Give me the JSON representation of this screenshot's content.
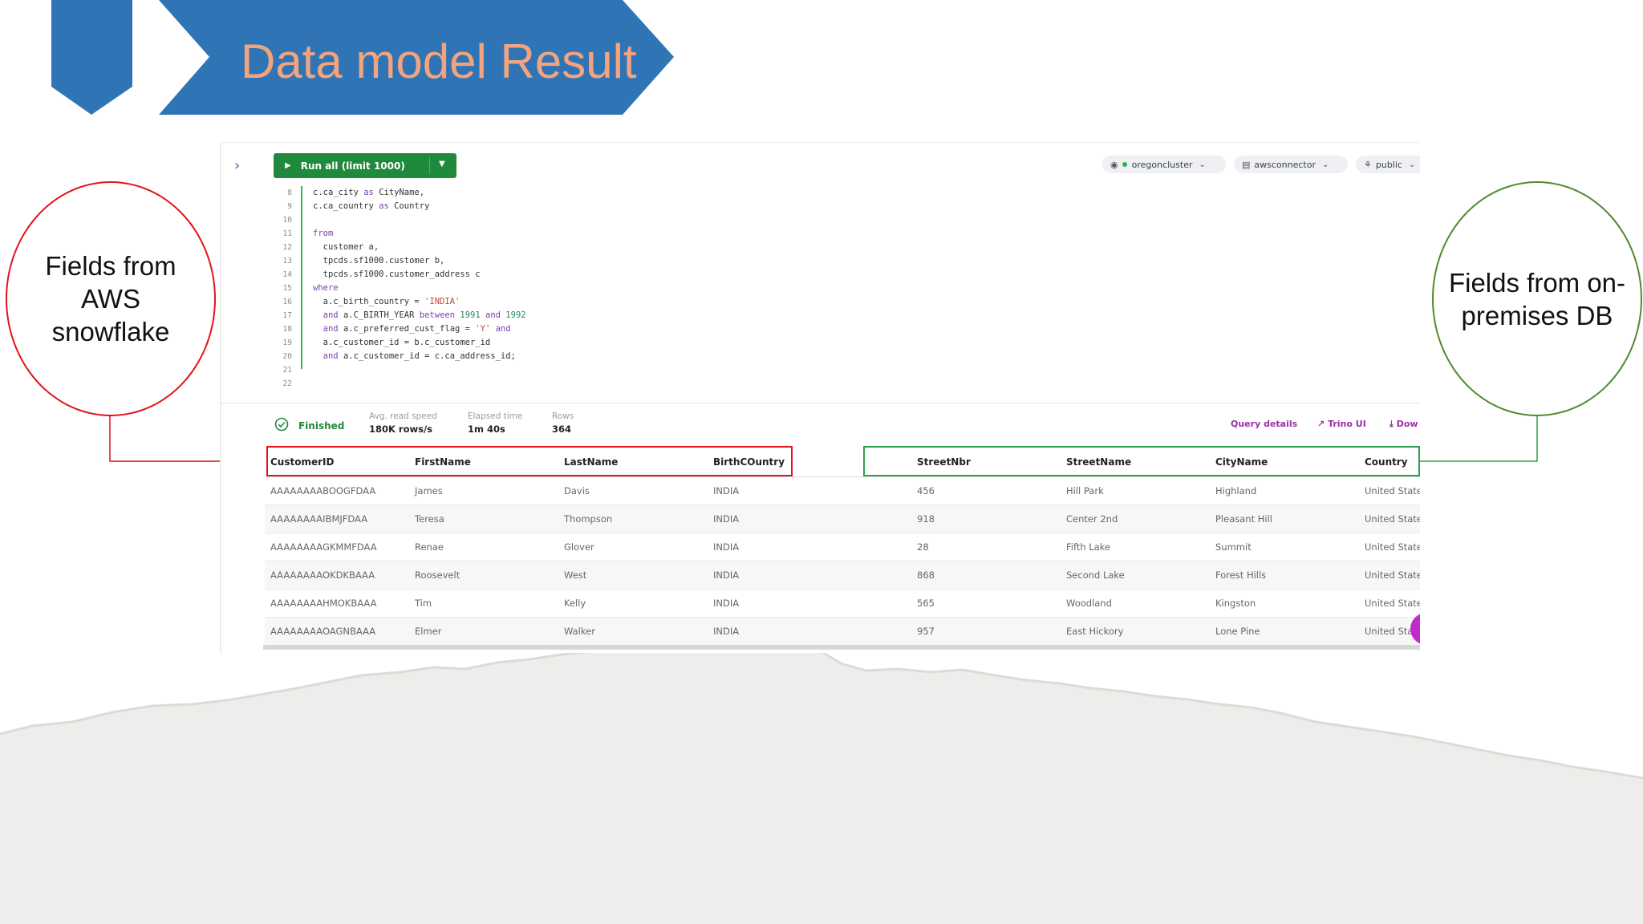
{
  "slide": {
    "title": "Data model Result",
    "callout_left": "Fields from AWS snowflake",
    "callout_right": "Fields from on-premises DB",
    "colors": {
      "banner": "#2f75b5",
      "title_text": "#f4a37f",
      "left_callout": "#e0141c",
      "right_callout": "#4e8a2f"
    }
  },
  "toolbar": {
    "run_label": "Run all (limit 1000)",
    "cluster": "oregoncluster",
    "connector": "awsconnector",
    "schema": "public"
  },
  "editor": {
    "lines": [
      {
        "n": "8",
        "html": "c.ca_city <span class=\"kw\">as</span> CityName,"
      },
      {
        "n": "9",
        "html": "c.ca_country <span class=\"kw\">as</span> Country"
      },
      {
        "n": "10",
        "html": ""
      },
      {
        "n": "11",
        "html": "<span class=\"kw\">from</span>"
      },
      {
        "n": "12",
        "html": "  customer a,"
      },
      {
        "n": "13",
        "html": "  tpcds.sf1000.customer b,"
      },
      {
        "n": "14",
        "html": "  tpcds.sf1000.customer_address c"
      },
      {
        "n": "15",
        "html": "<span class=\"kw\">where</span>"
      },
      {
        "n": "16",
        "html": "  a.c_birth_country = <span class=\"str\">'INDIA'</span>"
      },
      {
        "n": "17",
        "html": "  <span class=\"kw\">and</span> a.C_BIRTH_YEAR <span class=\"kw\">between</span> <span class=\"num\">1991</span> <span class=\"kw\">and</span> <span class=\"num\">1992</span>"
      },
      {
        "n": "18",
        "html": "  <span class=\"kw\">and</span> a.c_preferred_cust_flag = <span class=\"str\">'Y'</span> <span class=\"kw\">and</span>"
      },
      {
        "n": "19",
        "html": "  a.c_customer_id = b.c_customer_id"
      },
      {
        "n": "20",
        "html": "  <span class=\"kw\">and</span> a.c_customer_id = c.ca_address_id;"
      },
      {
        "n": "21",
        "html": ""
      },
      {
        "n": "22",
        "html": ""
      }
    ]
  },
  "status": {
    "state": "Finished",
    "avg_read_speed_label": "Avg. read speed",
    "avg_read_speed": "180K rows/s",
    "elapsed_label": "Elapsed time",
    "elapsed": "1m 40s",
    "rows_label": "Rows",
    "rows": "364",
    "query_details": "Query details",
    "trino_ui": "Trino UI",
    "download": "Dow"
  },
  "results": {
    "columns": [
      "CustomerID",
      "FirstName",
      "LastName",
      "BirthCOuntry",
      "",
      "StreetNbr",
      "StreetName",
      "CityName",
      "Country"
    ],
    "rows": [
      [
        "AAAAAAAABOOGFDAA",
        "James",
        "Davis",
        "INDIA",
        "",
        "456",
        "Hill Park",
        "Highland",
        "United States"
      ],
      [
        "AAAAAAAAIBMJFDAA",
        "Teresa",
        "Thompson",
        "INDIA",
        "",
        "918",
        "Center 2nd",
        "Pleasant Hill",
        "United States"
      ],
      [
        "AAAAAAAAGKMMFDAA",
        "Renae",
        "Glover",
        "INDIA",
        "",
        "28",
        "Fifth Lake",
        "Summit",
        "United States"
      ],
      [
        "AAAAAAAAOKDKBAAA",
        "Roosevelt",
        "West",
        "INDIA",
        "",
        "868",
        "Second Lake",
        "Forest Hills",
        "United States"
      ],
      [
        "AAAAAAAAHMOKBAAA",
        "Tim",
        "Kelly",
        "INDIA",
        "",
        "565",
        "Woodland",
        "Kingston",
        "United States"
      ],
      [
        "AAAAAAAAOAGNBAAA",
        "Elmer",
        "Walker",
        "INDIA",
        "",
        "957",
        "East Hickory",
        "Lone Pine",
        "United States"
      ]
    ]
  }
}
